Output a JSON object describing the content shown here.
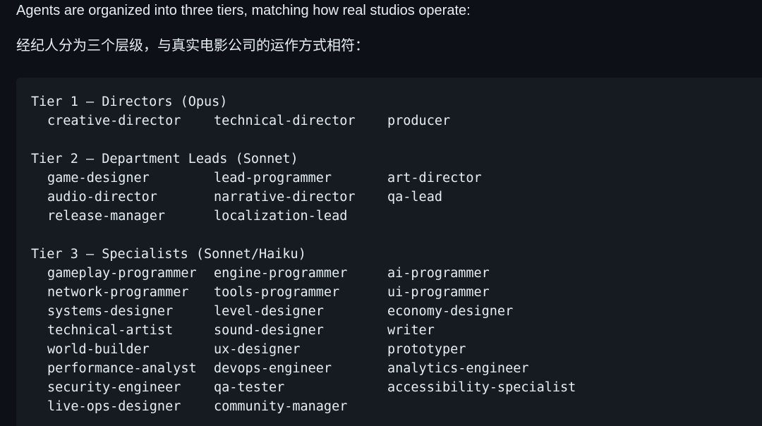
{
  "intro_en": "Agents are organized into three tiers, matching how real studios operate:",
  "intro_zh": "经纪人分为三个层级，与真实电影公司的运作方式相符：",
  "tiers": [
    {
      "header": "Tier 1 — Directors (Opus)",
      "rows": [
        [
          "creative-director",
          "technical-director",
          "producer"
        ]
      ]
    },
    {
      "header": "Tier 2 — Department Leads (Sonnet)",
      "rows": [
        [
          "game-designer",
          "lead-programmer",
          "art-director"
        ],
        [
          "audio-director",
          "narrative-director",
          "qa-lead"
        ],
        [
          "release-manager",
          "localization-lead",
          ""
        ]
      ]
    },
    {
      "header": "Tier 3 — Specialists (Sonnet/Haiku)",
      "rows": [
        [
          "gameplay-programmer",
          "engine-programmer",
          "ai-programmer"
        ],
        [
          "network-programmer",
          "tools-programmer",
          "ui-programmer"
        ],
        [
          "systems-designer",
          "level-designer",
          "economy-designer"
        ],
        [
          "technical-artist",
          "sound-designer",
          "writer"
        ],
        [
          "world-builder",
          "ux-designer",
          "prototyper"
        ],
        [
          "performance-analyst",
          "devops-engineer",
          "analytics-engineer"
        ],
        [
          "security-engineer",
          "qa-tester",
          "accessibility-specialist"
        ],
        [
          "live-ops-designer",
          "community-manager",
          ""
        ]
      ]
    }
  ]
}
